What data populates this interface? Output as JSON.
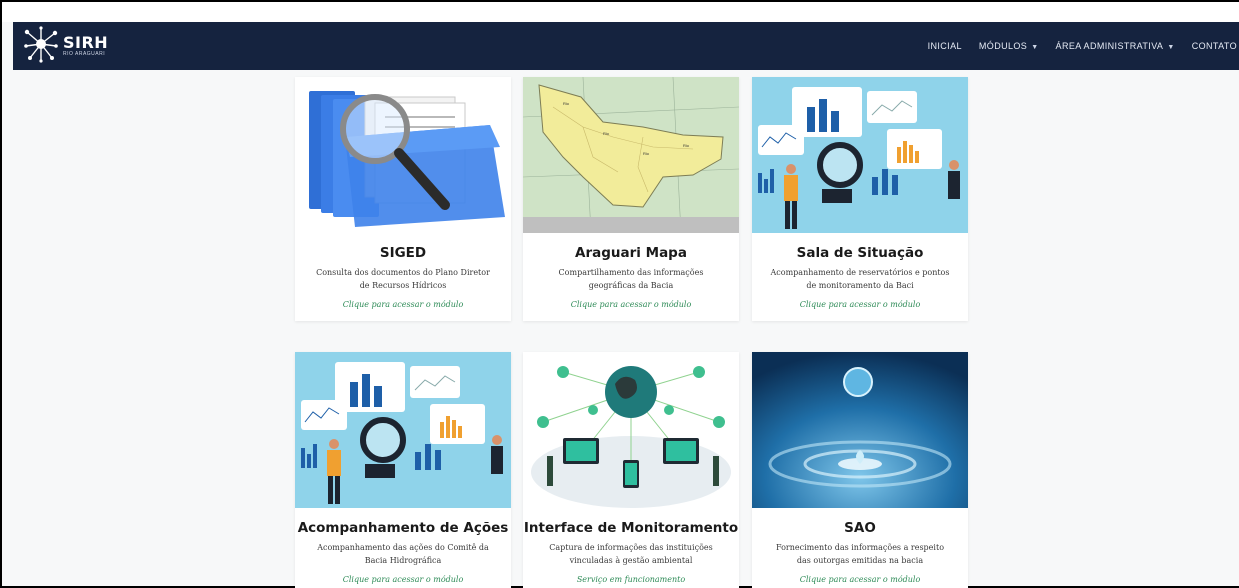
{
  "brand": {
    "title": "SIRH",
    "subtitle": "RIO ARAGUARI"
  },
  "nav": {
    "items": [
      {
        "label": "INICIAL",
        "dropdown": false
      },
      {
        "label": "MÓDULOS",
        "dropdown": true
      },
      {
        "label": "ÁREA ADMINISTRATIVA",
        "dropdown": true
      },
      {
        "label": "CONTATO",
        "dropdown": false
      }
    ]
  },
  "cards": [
    {
      "title": "SIGED",
      "description": "Consulta dos documentos do Plano Diretor de Recursos Hídricos",
      "link": "Clique para acessar o módulo",
      "image_icon": "documents-magnifier-image"
    },
    {
      "title": "Araguari Mapa",
      "description": "Compartilhamento das informações geográficas da Bacia",
      "link": "Clique para acessar o módulo",
      "image_icon": "basin-map-image"
    },
    {
      "title": "Sala de Situação",
      "description": "Acompanhamento de reservatórios e pontos de monitoramento da Baci",
      "link": "Clique para acessar o módulo",
      "image_icon": "dashboard-analytics-image"
    },
    {
      "title": "Acompanhamento de Ações",
      "description": "Acompanhamento das ações do Comitê da Bacia Hidrográfica",
      "link": "Clique para acessar o módulo",
      "image_icon": "dashboard-analytics-image"
    },
    {
      "title": "Interface de Monitoramento",
      "description": "Captura de informações das instituições vinculadas à gestão ambiental",
      "link": "Serviço em funcionamento",
      "image_icon": "network-globe-image"
    },
    {
      "title": "SAO",
      "description": "Fornecimento das informações a respeito das outorgas emitidas na bacia",
      "link": "Clique para acessar o módulo",
      "image_icon": "water-drop-image"
    }
  ],
  "colors": {
    "navbar": "#15233f",
    "link": "#2e8b57",
    "background": "#f7f8f9"
  }
}
